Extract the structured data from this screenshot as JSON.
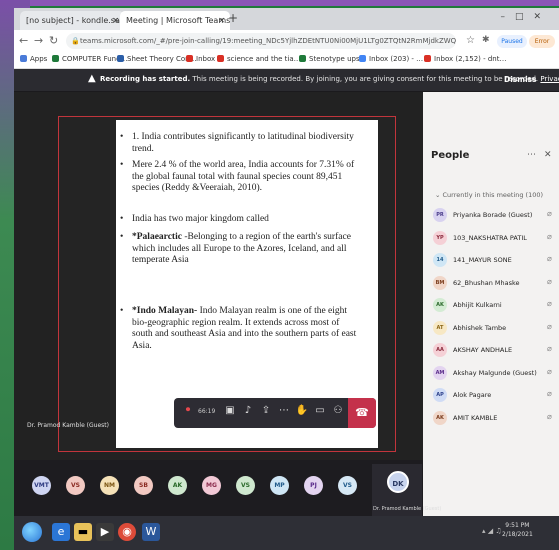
{
  "browser": {
    "tabs": [
      {
        "label": "[no subject] - kondle.sayan…",
        "active": false
      },
      {
        "label": "Meeting | Microsoft Teams",
        "active": true
      }
    ],
    "address": "teams.microsoft.com/_#/pre-join-calling/19:meeting_NDc5YjlhZDEtNTU0Ni00MjU1LTg0ZTQtN2RmMjdkZWQ0@thread.v2",
    "profile_label": "Paused",
    "update_label": "Error",
    "bookmarks": [
      {
        "label": "Apps",
        "color": "#4a7bd8"
      },
      {
        "label": "COMPUTER Fund…",
        "color": "#1f7a3a"
      },
      {
        "label": "Sheet Theory Con…",
        "color": "#2b5ea8"
      },
      {
        "label": "Inbox",
        "color": "#d93025"
      },
      {
        "label": "science and the tia…",
        "color": "#d93025"
      },
      {
        "label": "Stenotype ups",
        "color": "#1f7a3a"
      },
      {
        "label": "Inbox (203) - …",
        "color": "#4285f4"
      },
      {
        "label": "Inbox (2,152) - dnt…",
        "color": "#d93025"
      }
    ]
  },
  "banner": {
    "bold": "Recording has started.",
    "text": "This meeting is being recorded. By joining, you are giving consent for this meeting to be recorded.",
    "link": "Privacy policy",
    "dismiss": "Dismiss"
  },
  "slide": {
    "bullets": [
      {
        "marker": "•",
        "text": "1. India contributes significantly to latitudinal biodiversity trend."
      },
      {
        "marker": "•",
        "text": "Mere 2.4 % of the world area, India accounts for 7.31% of the global faunal total with faunal species count 89,451 species (Reddy &Veeraiah, 2010)."
      },
      {
        "marker": "•",
        "text": "India has two major kingdom called"
      },
      {
        "marker": "•",
        "bold": "*Palaearctic",
        "text": " -Belonging to a region of the earth's surface which includes all Europe to the Azores, Iceland, and all temperate Asia"
      },
      {
        "marker": "•",
        "bold": "*Indo Malayan-",
        "text": " Indo Malayan realm is one of the eight bio-geographic region realm. It extends across most of south and southeast Asia and into the southern parts of east Asia."
      }
    ]
  },
  "stage": {
    "presenter_name": "Dr. Pramod Kamble (Guest)"
  },
  "controls": {
    "timer": "66:19"
  },
  "people_panel": {
    "title": "People",
    "section": "Currently in this meeting (100)",
    "people": [
      {
        "initials": "PR",
        "name": "Priyanka Borade (Guest)",
        "bg": "#d8d2f0",
        "fg": "#4a3c8a"
      },
      {
        "initials": "YP",
        "name": "103_NAKSHATRA PATIL",
        "bg": "#f5d0d6",
        "fg": "#8a2b3c"
      },
      {
        "initials": "14",
        "name": "141_MAYUR SONE",
        "bg": "#cfe6f5",
        "fg": "#1f5a8a"
      },
      {
        "initials": "BM",
        "name": "62_Bhushan Mhaske",
        "bg": "#f0d6c8",
        "fg": "#7a3b1c"
      },
      {
        "initials": "AK",
        "name": "Abhijit Kulkarni",
        "bg": "#d4ecd4",
        "fg": "#2b6a2b"
      },
      {
        "initials": "AT",
        "name": "Abhishek Tambe",
        "bg": "#f7e8c4",
        "fg": "#8a6414"
      },
      {
        "initials": "AA",
        "name": "AKSHAY ANDHALE",
        "bg": "#f5d0d6",
        "fg": "#8a2b3c"
      },
      {
        "initials": "AM",
        "name": "Akshay Malgunde (Guest)",
        "bg": "#e3d4f0",
        "fg": "#5a2b8a"
      },
      {
        "initials": "AP",
        "name": "Alok Pagare",
        "bg": "#d0dcf5",
        "fg": "#2b3f8a"
      },
      {
        "initials": "AK",
        "name": "AMIT KAMBLE",
        "bg": "#f0d6c8",
        "fg": "#7a3b1c"
      }
    ]
  },
  "strip": {
    "participants": [
      {
        "initials": "VMT",
        "bg": "#cfd5f2",
        "fg": "#2e3a80"
      },
      {
        "initials": "VS",
        "bg": "#f2c9c2",
        "fg": "#8a2b22"
      },
      {
        "initials": "NM",
        "bg": "#f5e1b8",
        "fg": "#7a5412"
      },
      {
        "initials": "SB",
        "bg": "#f2c9c2",
        "fg": "#8a2b22"
      },
      {
        "initials": "AK",
        "bg": "#cfe8cf",
        "fg": "#2b6a2b"
      },
      {
        "initials": "MG",
        "bg": "#f2c9d6",
        "fg": "#8a2b4c"
      },
      {
        "initials": "VS",
        "bg": "#cfe8cf",
        "fg": "#2b6a2b"
      },
      {
        "initials": "MP",
        "bg": "#cfe6f5",
        "fg": "#1f5a8a"
      },
      {
        "initials": "PJ",
        "bg": "#e3d4f0",
        "fg": "#5a2b8a"
      },
      {
        "initials": "VS",
        "bg": "#d6e8f5",
        "fg": "#1f5a8a"
      }
    ],
    "speaker": {
      "initials": "DK",
      "name": "Dr. Pramod Kamble (Guest)"
    }
  },
  "taskbar": {
    "time": "9:51 PM",
    "date": "2/18/2021"
  }
}
